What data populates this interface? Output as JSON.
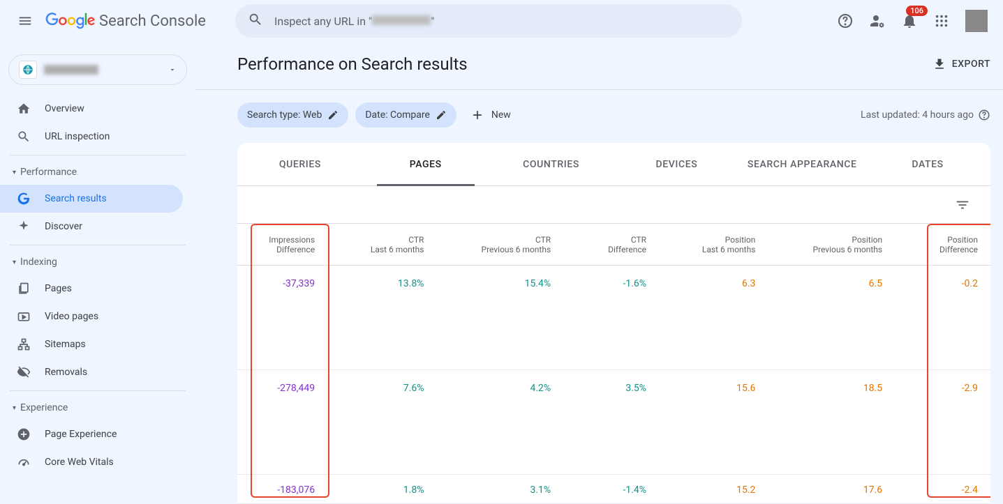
{
  "header": {
    "product_name": "Search Console",
    "search_placeholder_prefix": "Inspect any URL in \"",
    "search_placeholder_suffix": "\"",
    "notification_count": "106"
  },
  "sidebar": {
    "overview": "Overview",
    "url_inspection": "URL inspection",
    "section_performance": "Performance",
    "search_results": "Search results",
    "discover": "Discover",
    "section_indexing": "Indexing",
    "pages": "Pages",
    "video_pages": "Video pages",
    "sitemaps": "Sitemaps",
    "removals": "Removals",
    "section_experience": "Experience",
    "page_experience": "Page Experience",
    "core_web_vitals": "Core Web Vitals"
  },
  "main": {
    "title": "Performance on Search results",
    "export": "EXPORT",
    "chip_search_type": "Search type: Web",
    "chip_date": "Date: Compare",
    "new": "New",
    "last_updated": "Last updated: 4 hours ago"
  },
  "tabs": {
    "queries": "QUERIES",
    "pages": "PAGES",
    "countries": "COUNTRIES",
    "devices": "DEVICES",
    "search_appearance": "SEARCH APPEARANCE",
    "dates": "DATES"
  },
  "table": {
    "headers": {
      "impressions_diff_l1": "Impressions",
      "impressions_diff_l2": "Difference",
      "ctr_last_l1": "CTR",
      "ctr_last_l2": "Last 6 months",
      "ctr_prev_l1": "CTR",
      "ctr_prev_l2": "Previous 6 months",
      "ctr_diff_l1": "CTR",
      "ctr_diff_l2": "Difference",
      "pos_last_l1": "Position",
      "pos_last_l2": "Last 6 months",
      "pos_prev_l1": "Position",
      "pos_prev_l2": "Previous 6 months",
      "pos_diff_l1": "Position",
      "pos_diff_l2": "Difference"
    },
    "rows": [
      {
        "imp_diff": "-37,339",
        "ctr_last": "13.8%",
        "ctr_prev": "15.4%",
        "ctr_diff": "-1.6%",
        "pos_last": "6.3",
        "pos_prev": "6.5",
        "pos_diff": "-0.2"
      },
      {
        "imp_diff": "-278,449",
        "ctr_last": "7.6%",
        "ctr_prev": "4.2%",
        "ctr_diff": "3.5%",
        "pos_last": "15.6",
        "pos_prev": "18.5",
        "pos_diff": "-2.9"
      },
      {
        "imp_diff": "-183,076",
        "ctr_last": "1.8%",
        "ctr_prev": "3.1%",
        "ctr_diff": "-1.4%",
        "pos_last": "15.2",
        "pos_prev": "17.6",
        "pos_diff": "-2.4"
      }
    ]
  }
}
